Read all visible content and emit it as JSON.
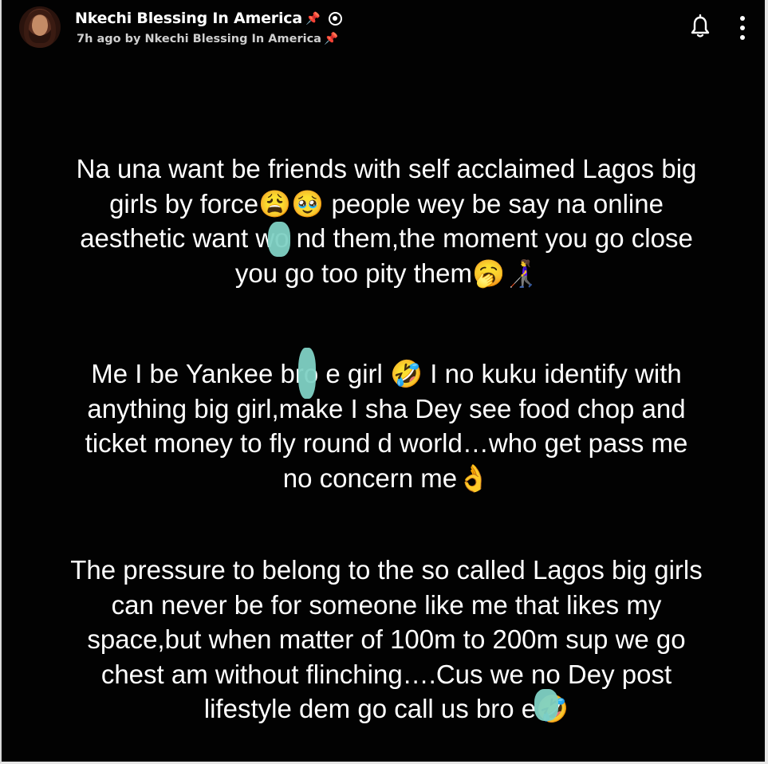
{
  "header": {
    "account_name": "Nkechi Blessing In America",
    "account_name_suffix_emoji": "📌",
    "subtitle": "7h ago by Nkechi Blessing In America",
    "subtitle_suffix_emoji": "📌"
  },
  "icons": {
    "avatar": "profile-photo",
    "verified": "verified-badge-icon",
    "bell": "bell-icon",
    "menu": "more-vertical-icon"
  },
  "post": {
    "paragraphs": [
      "Na una want be friends with self acclaimed Lagos big\ngirls by force😩🥹 people wey be say na online\naesthetic want wo  nd them,the moment you go close\nyou go too pity them🥱👩‍🦯",
      "Me I be Yankee bro  e girl 🤣 I no kuku identify with\nanything big girl,make I sha Dey see food chop and\nticket money to fly round d world…who get pass me\nno concern me👌",
      "The pressure to belong to the so called Lagos big girls\ncan never be for someone like me that likes my\nspace,but when matter of 100m to 200m sup we go\nchest am without flinching….Cus we no Dey post\nlifestyle dem go call us bro  e🤣"
    ]
  },
  "colors": {
    "background": "#020202",
    "text": "#ffffff",
    "subtext": "#cfcfcf",
    "redaction": "#7fd1c4",
    "pin": "#e0303b"
  }
}
